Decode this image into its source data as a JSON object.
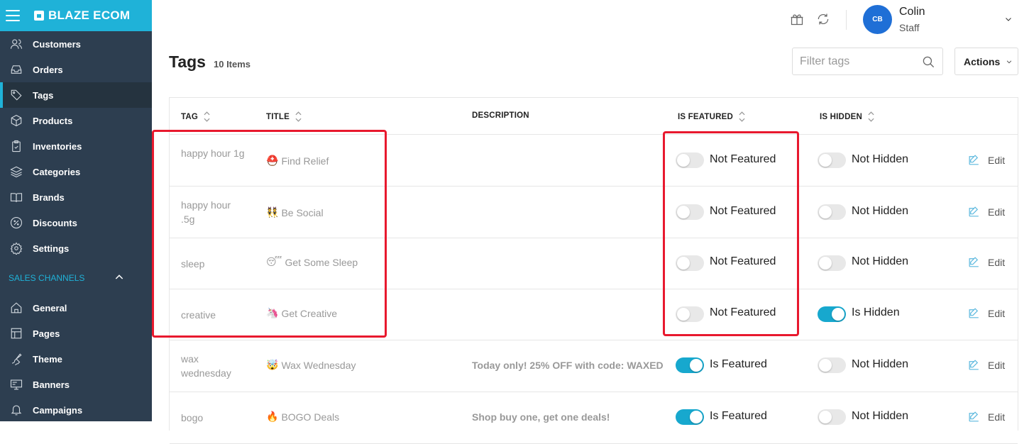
{
  "brand": {
    "name": "BLAZE ECOM"
  },
  "sidebar": {
    "items": [
      {
        "label": "Customers",
        "icon": "users-icon"
      },
      {
        "label": "Orders",
        "icon": "inbox-icon"
      },
      {
        "label": "Tags",
        "icon": "tag-icon",
        "active": true
      },
      {
        "label": "Products",
        "icon": "box-icon"
      },
      {
        "label": "Inventories",
        "icon": "clipboard-icon"
      },
      {
        "label": "Categories",
        "icon": "layers-icon"
      },
      {
        "label": "Brands",
        "icon": "book-icon"
      },
      {
        "label": "Discounts",
        "icon": "percent-icon"
      },
      {
        "label": "Settings",
        "icon": "gear-icon"
      }
    ],
    "section_title": "SALES CHANNELS",
    "channel_items": [
      {
        "label": "General",
        "icon": "home-icon"
      },
      {
        "label": "Pages",
        "icon": "layout-icon"
      },
      {
        "label": "Theme",
        "icon": "brush-icon"
      },
      {
        "label": "Banners",
        "icon": "monitor-icon"
      },
      {
        "label": "Campaigns",
        "icon": "bell-icon"
      }
    ]
  },
  "user": {
    "initials": "CB",
    "name": "Colin",
    "role": "Staff"
  },
  "page": {
    "title": "Tags",
    "count": "10 Items"
  },
  "filter": {
    "placeholder": "Filter tags"
  },
  "actions": {
    "label": "Actions"
  },
  "table": {
    "columns": {
      "tag": "TAG",
      "title": "TITLE",
      "description": "DESCRIPTION",
      "featured": "IS FEATURED",
      "hidden": "IS HIDDEN"
    },
    "edit_label": "Edit",
    "rows": [
      {
        "tag": "happy hour 1g",
        "emoji": "⛑️",
        "title": "Find Relief",
        "description": "",
        "featured": false,
        "featured_label": "Not Featured",
        "hidden": false,
        "hidden_label": "Not Hidden"
      },
      {
        "tag": "happy hour .5g",
        "emoji": "👯",
        "title": "Be Social",
        "description": "",
        "featured": false,
        "featured_label": "Not Featured",
        "hidden": false,
        "hidden_label": "Not Hidden"
      },
      {
        "tag": "sleep",
        "emoji": "😴",
        "title": "Get Some Sleep",
        "description": "",
        "featured": false,
        "featured_label": "Not Featured",
        "hidden": false,
        "hidden_label": "Not Hidden"
      },
      {
        "tag": "creative",
        "emoji": "🦄",
        "title": "Get Creative",
        "description": "",
        "featured": false,
        "featured_label": "Not Featured",
        "hidden": true,
        "hidden_label": "Is Hidden"
      },
      {
        "tag": "wax wednesday",
        "emoji": "🤯",
        "title": "Wax Wednesday",
        "description": "Today only! 25% OFF with code: WAXED",
        "featured": true,
        "featured_label": "Is Featured",
        "hidden": false,
        "hidden_label": "Not Hidden"
      },
      {
        "tag": "bogo",
        "emoji": "🔥",
        "title": "BOGO Deals",
        "description": "Shop buy one, get one deals!",
        "featured": true,
        "featured_label": "Is Featured",
        "hidden": false,
        "hidden_label": "Not Hidden"
      }
    ]
  }
}
